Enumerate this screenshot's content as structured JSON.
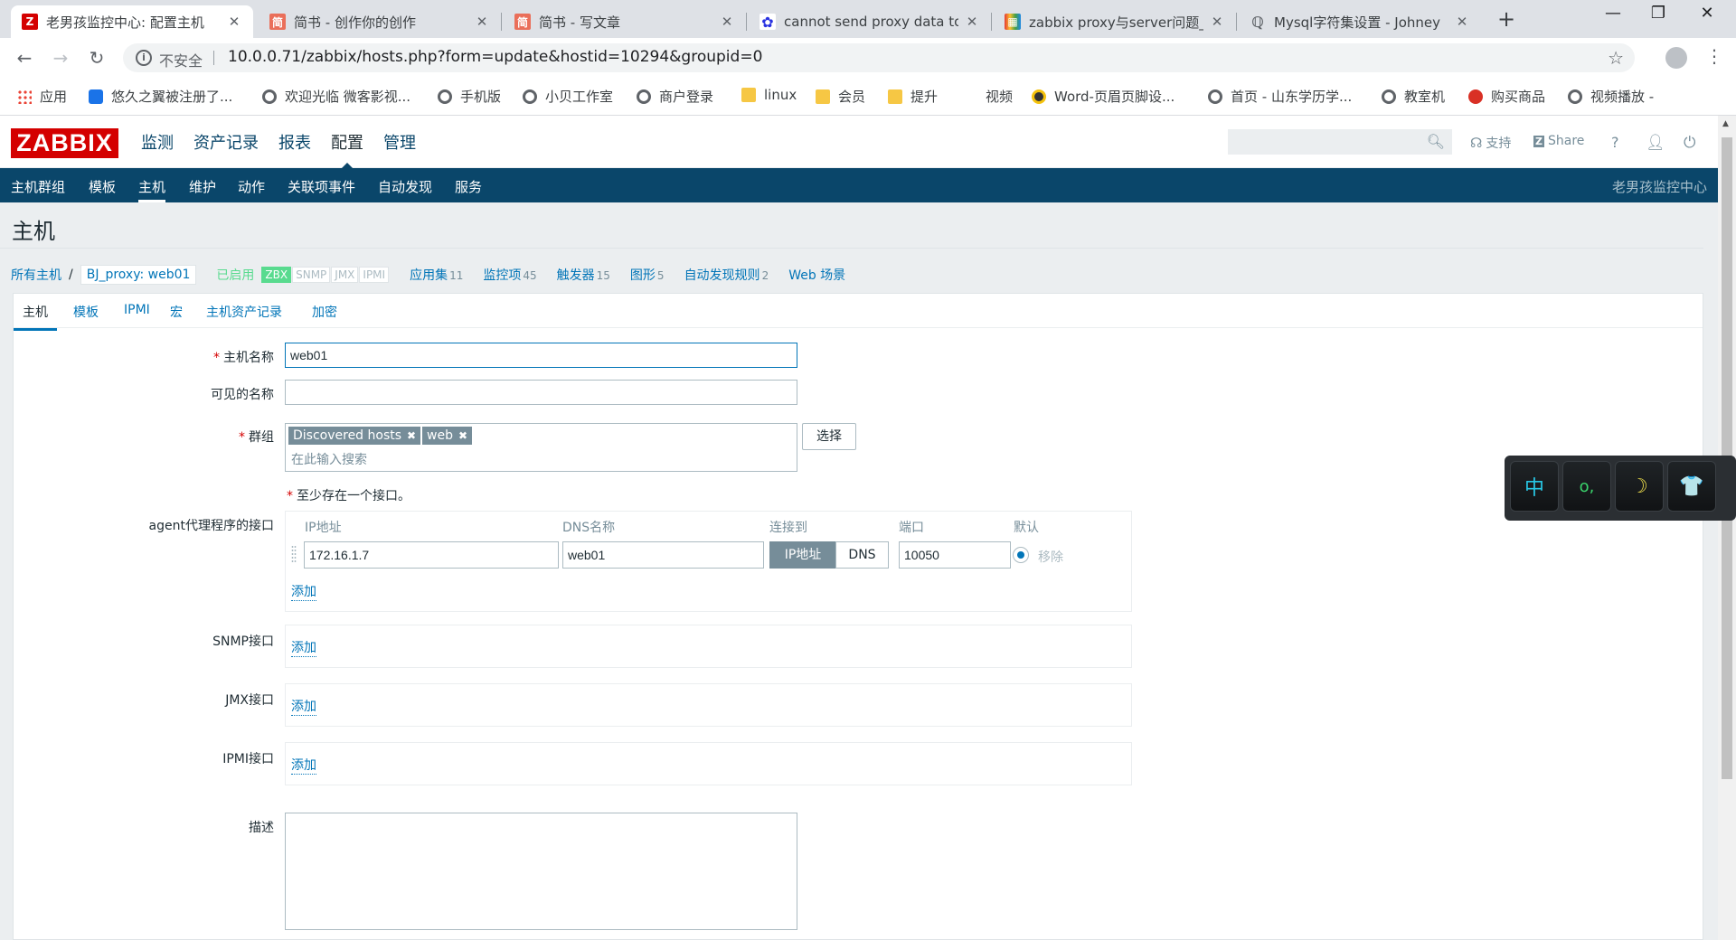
{
  "browser": {
    "tabs": [
      {
        "title": "老男孩监控中心: 配置主机",
        "favicon": "zabbix-favicon",
        "color": "#d40000",
        "glyph": "Z",
        "active": true
      },
      {
        "title": "简书 - 创作你的创作",
        "favicon": "jianshu-favicon",
        "color": "#ea6f5a",
        "glyph": "简",
        "active": false
      },
      {
        "title": "简书 - 写文章",
        "favicon": "jianshu-favicon",
        "color": "#ea6f5a",
        "glyph": "简",
        "active": false
      },
      {
        "title": "cannot send proxy data to",
        "favicon": "baidu-favicon",
        "color": "#2932e1",
        "glyph": "✿",
        "active": false
      },
      {
        "title": "zabbix proxy与server问题_",
        "favicon": "csdn-favicon",
        "color": "#fc5531",
        "glyph": "▦",
        "active": false
      },
      {
        "title": "Mysql字符集设置 - Johney",
        "favicon": "cnblogs-favicon",
        "color": "#5f6368",
        "glyph": "ℚ",
        "active": false
      }
    ],
    "new_tab": "+",
    "window": {
      "minimize": "—",
      "maximize": "❐",
      "close": "✕"
    },
    "security_label": "不安全",
    "url": "10.0.0.71/zabbix/hosts.php?form=update&hostid=10294&groupid=0",
    "bookmarks": [
      {
        "label": "应用",
        "icon": "apps"
      },
      {
        "label": "悠久之翼被注册了...",
        "icon": "blue"
      },
      {
        "label": "欢迎光临 微客影视...",
        "icon": "globe"
      },
      {
        "label": "手机版",
        "icon": "globe"
      },
      {
        "label": "小贝工作室",
        "icon": "globe"
      },
      {
        "label": "商户登录",
        "icon": "globe"
      },
      {
        "label": "linux",
        "icon": "folder"
      },
      {
        "label": "会员",
        "icon": "folder"
      },
      {
        "label": "提升",
        "icon": "folder"
      },
      {
        "label": "视频",
        "icon": "none"
      },
      {
        "label": "Word-页眉页脚设...",
        "icon": "yellow"
      },
      {
        "label": "首页 - 山东学历学...",
        "icon": "globe"
      },
      {
        "label": "教室机",
        "icon": "globe"
      },
      {
        "label": "购买商品",
        "icon": "red"
      },
      {
        "label": "视频播放 -",
        "icon": "globe"
      }
    ]
  },
  "zabbix": {
    "logo": "ZABBIX",
    "top_menu": [
      "监测",
      "资产记录",
      "报表",
      "配置",
      "管理"
    ],
    "top_menu_selected": 3,
    "support": "支持",
    "share": "Share",
    "help": "?",
    "sub_menu": [
      "主机群组",
      "模板",
      "主机",
      "维护",
      "动作",
      "关联项事件",
      "自动发现",
      "服务"
    ],
    "sub_menu_selected": 2,
    "server_name": "老男孩监控中心",
    "page_title": "主机",
    "breadcrumb": {
      "all_hosts": "所有主机",
      "separator": "/",
      "current": "BJ_proxy: web01",
      "status": "已启用",
      "availability": [
        "ZBX",
        "SNMP",
        "JMX",
        "IPMI"
      ],
      "counts": [
        {
          "label": "应用集",
          "num": "11"
        },
        {
          "label": "监控项",
          "num": "45"
        },
        {
          "label": "触发器",
          "num": "15"
        },
        {
          "label": "图形",
          "num": "5"
        },
        {
          "label": "自动发现规则",
          "num": "2"
        },
        {
          "label": "Web 场景",
          "num": ""
        }
      ]
    },
    "form_tabs": [
      "主机",
      "模板",
      "IPMI",
      "宏",
      "主机资产记录",
      "加密"
    ],
    "form": {
      "host_name_label": "主机名称",
      "host_name_value": "web01",
      "visible_name_label": "可见的名称",
      "visible_name_value": "",
      "groups_label": "群组",
      "groups": [
        "Discovered hosts",
        "web"
      ],
      "groups_placeholder": "在此输入搜索",
      "select_button": "选择",
      "interface_warning": "至少存在一个接口。",
      "agent_label": "agent代理程序的接口",
      "iface_headers": {
        "ip": "IP地址",
        "dns": "DNS名称",
        "connect": "连接到",
        "port": "端口",
        "default": "默认"
      },
      "agent_iface": {
        "ip": "172.16.1.7",
        "dns": "web01",
        "connect_ip": "IP地址",
        "connect_dns": "DNS",
        "port": "10050",
        "remove": "移除"
      },
      "add_link": "添加",
      "snmp_label": "SNMP接口",
      "jmx_label": "JMX接口",
      "ipmi_label": "IPMI接口",
      "description_label": "描述",
      "description_value": ""
    }
  },
  "ime_toolbar": {
    "keys": [
      "中",
      "o,",
      "☽",
      "👕"
    ]
  }
}
